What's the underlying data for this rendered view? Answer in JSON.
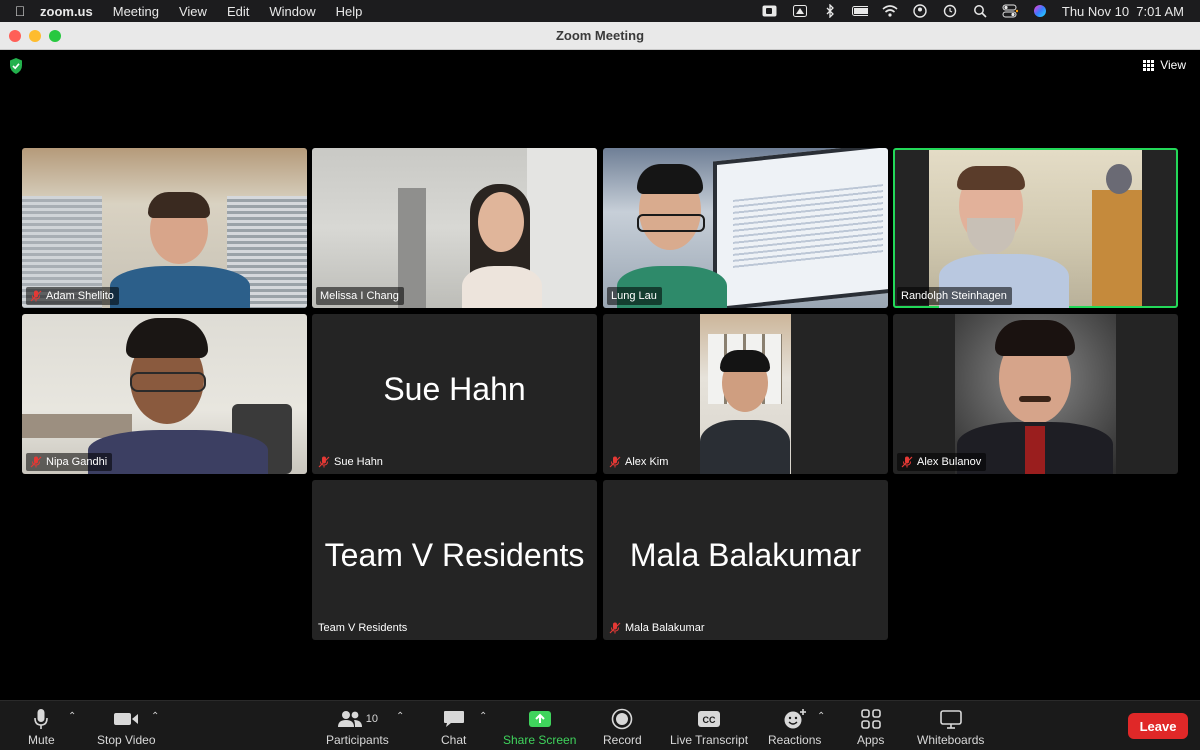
{
  "menubar": {
    "app_name": "zoom.us",
    "menus": [
      "Meeting",
      "View",
      "Edit",
      "Window",
      "Help"
    ],
    "clock": "Thu Nov 10  7:01 AM",
    "status_icons": [
      "camera-icon",
      "drive-icon",
      "bluetooth-icon",
      "battery-icon",
      "wifi-icon",
      "user-icon",
      "time-machine-icon",
      "search-icon",
      "control-center-icon",
      "siri-icon"
    ]
  },
  "window": {
    "title": "Zoom Meeting"
  },
  "header": {
    "view_label": "View"
  },
  "participants": [
    {
      "name": "Adam Shellito",
      "muted": true,
      "video": true,
      "active": false
    },
    {
      "name": "Melissa I Chang",
      "muted": false,
      "video": true,
      "active": false
    },
    {
      "name": "Lung Lau",
      "muted": false,
      "video": true,
      "active": false
    },
    {
      "name": "Randolph Steinhagen",
      "muted": false,
      "video": true,
      "active": true
    },
    {
      "name": "Nipa Gandhi",
      "muted": true,
      "video": true,
      "active": false
    },
    {
      "name": "Sue Hahn",
      "muted": true,
      "video": false,
      "active": false
    },
    {
      "name": "Alex Kim",
      "muted": true,
      "video": true,
      "active": false
    },
    {
      "name": "Alex Bulanov",
      "muted": true,
      "video": true,
      "active": false
    },
    {
      "name": "Team V Residents",
      "muted": false,
      "video": false,
      "active": false
    },
    {
      "name": "Mala Balakumar",
      "muted": true,
      "video": false,
      "active": false
    }
  ],
  "toolbar": {
    "mute": "Mute",
    "stop_video": "Stop Video",
    "participants": "Participants",
    "participant_count": "10",
    "chat": "Chat",
    "share_screen": "Share Screen",
    "record": "Record",
    "live_transcript": "Live Transcript",
    "reactions": "Reactions",
    "apps": "Apps",
    "whiteboards": "Whiteboards",
    "leave": "Leave"
  },
  "colors": {
    "active_speaker": "#23d959",
    "share_green": "#3fd35c",
    "leave_red": "#e02828",
    "tile_bg": "#242424"
  }
}
